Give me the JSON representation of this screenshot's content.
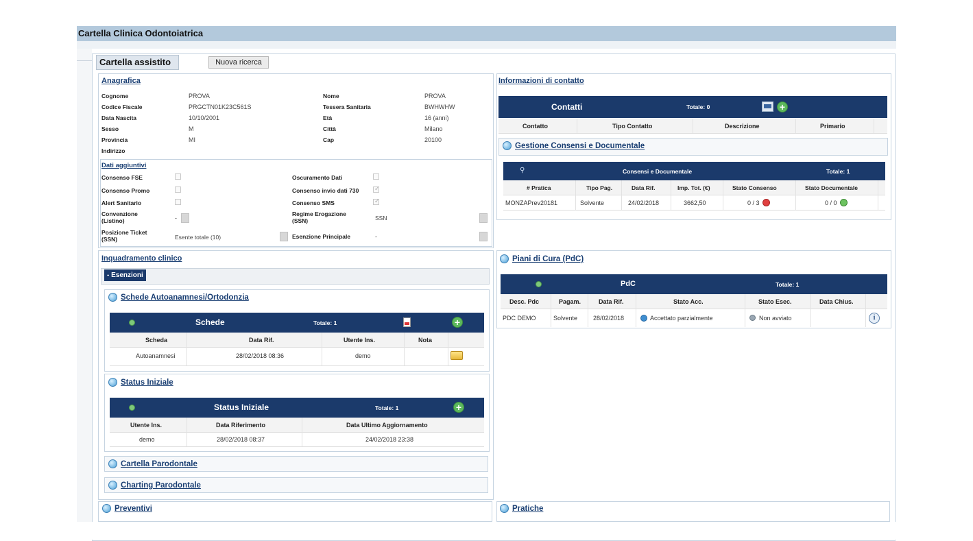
{
  "app_title": "Cartella Clinica Odontoiatrica",
  "header": {
    "title": "Cartella assistito",
    "new_search": "Nuova ricerca"
  },
  "anagrafica": {
    "title": "Anagrafica",
    "left": [
      {
        "label": "Cognome",
        "value": "PROVA"
      },
      {
        "label": "Codice Fiscale",
        "value": "PRGCTN01K23C561S"
      },
      {
        "label": "Data Nascita",
        "value": "10/10/2001"
      },
      {
        "label": "Sesso",
        "value": "M"
      },
      {
        "label": "Provincia",
        "value": "MI"
      },
      {
        "label": "Indirizzo",
        "value": ""
      }
    ],
    "right": [
      {
        "label": "Nome",
        "value": "PROVA"
      },
      {
        "label": "Tessera Sanitaria",
        "value": "BWHWHW"
      },
      {
        "label": "Età",
        "value": "16 (anni)"
      },
      {
        "label": "Città",
        "value": "Milano"
      },
      {
        "label": "Cap",
        "value": "20100"
      }
    ]
  },
  "dati_aggiuntivi": {
    "title": "Dati aggiuntivi",
    "consenso_fse": "Consenso FSE",
    "consenso_promo": "Consenso Promo",
    "alert_sanitario": "Alert Sanitario",
    "convenzione_1": "Convenzione",
    "convenzione_2": "(Listino)",
    "convenzione_value": "-",
    "posizione_1": "Posizione Ticket",
    "posizione_2": "(SSN)",
    "posizione_value": "Esente totale (10)",
    "oscuramento": "Oscuramento Dati",
    "consenso_730": "Consenso invio dati 730",
    "consenso_sms": "Consenso SMS",
    "regime_1": "Regime Erogazione",
    "regime_2": "(SSN)",
    "regime_value": "SSN",
    "esenzione": "Esenzione Principale",
    "esenzione_value": "-"
  },
  "contatti_section": {
    "title": "Informazioni di contatto",
    "table_title": "Contatti",
    "total": "Totale: 0",
    "columns": [
      "Contatto",
      "Tipo Contatto",
      "Descrizione",
      "Primario"
    ]
  },
  "consensi": {
    "section_title": "Gestione Consensi e Documentale",
    "table_title": "Consensi e Documentale",
    "total": "Totale: 1",
    "columns": [
      "# Pratica",
      "Tipo Pag.",
      "Data Rif.",
      "Imp. Tot. (€)",
      "Stato Consenso",
      "Stato Documentale"
    ],
    "row": [
      "MONZAPrev20181",
      "Solvente",
      "24/02/2018",
      "3662,50",
      "0 / 3",
      "0 / 0"
    ]
  },
  "inquadramento": {
    "title": "Inquadramento clinico",
    "esenzioni": "- Esenzioni"
  },
  "schede": {
    "section_title": "Schede Autoanamnesi/Ortodonzia",
    "table_title": "Schede",
    "total": "Totale: 1",
    "columns": [
      "Scheda",
      "Data Rif.",
      "Utente Ins.",
      "Nota"
    ],
    "row": [
      "Autoanamnesi",
      "28/02/2018 08:36",
      "demo",
      ""
    ]
  },
  "status": {
    "section_title": "Status Iniziale",
    "table_title": "Status Iniziale",
    "total": "Totale: 1",
    "columns": [
      "Utente Ins.",
      "Data Riferimento",
      "Data Ultimo Aggiornamento"
    ],
    "row": [
      "demo",
      "28/02/2018 08:37",
      "24/02/2018 23:38"
    ]
  },
  "collapsed": {
    "parodontale": "Cartella Parodontale",
    "charting": "Charting Parodontale",
    "preventivi": "Preventivi",
    "pratiche": "Pratiche"
  },
  "pdc": {
    "section_title": "Piani di Cura (PdC)",
    "table_title": "PdC",
    "total": "Totale: 1",
    "columns": [
      "Desc. Pdc",
      "Pagam.",
      "Data Rif.",
      "Stato Acc.",
      "Stato Esec.",
      "Data Chius."
    ],
    "row": [
      "PDC DEMO",
      "Solvente",
      "28/02/2018",
      "Accettato parzialmente",
      "Non avviato",
      ""
    ]
  },
  "colors": {
    "navy": "#1b3a6b",
    "titlebar": "#b3c9dc",
    "link": "#1a3f73",
    "green": "#5cb85c",
    "red": "#e04040"
  },
  "icons": [
    "search-icon",
    "plus-icon",
    "pdf-icon",
    "folder-icon",
    "info-icon",
    "expand-icon",
    "printer-icon"
  ]
}
